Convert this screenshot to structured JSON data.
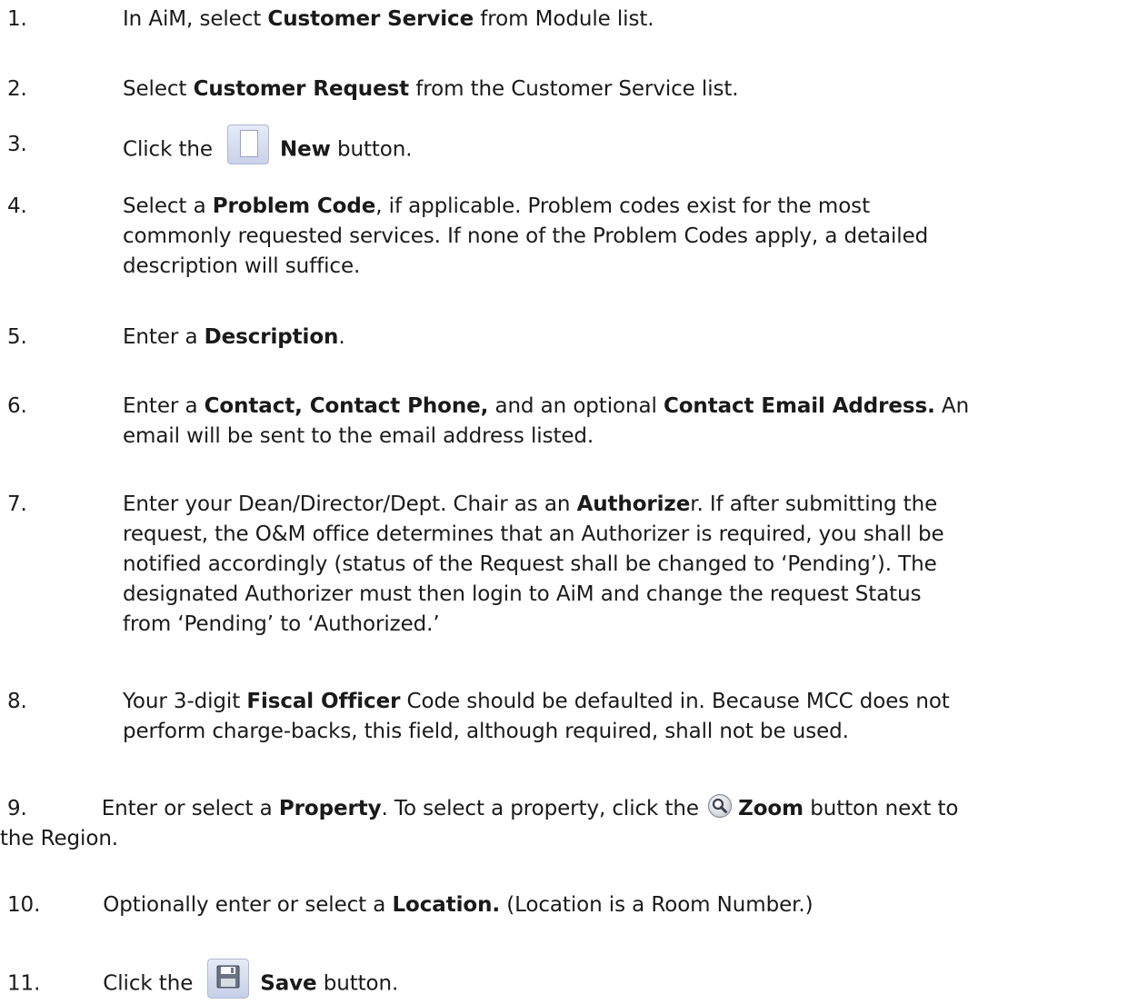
{
  "steps": [
    {
      "num": "1.",
      "parts": [
        "In AiM, select ",
        "Customer Service",
        " from Module list."
      ]
    },
    {
      "num": "2.",
      "parts": [
        "Select ",
        "Customer Request",
        " from the Customer Service list."
      ]
    },
    {
      "num": "3.",
      "parts": [
        "Click the",
        "New",
        " button."
      ],
      "icon": "new-document-icon"
    },
    {
      "num": "4.",
      "parts": [
        "Select a ",
        "Problem Code",
        ", if applicable.  Problem codes exist for the most",
        "commonly requested services.  If none of the Problem Codes apply, a detailed",
        "description will suffice."
      ]
    },
    {
      "num": "5.",
      "parts": [
        "Enter a ",
        "Description",
        "."
      ]
    },
    {
      "num": "6.",
      "parts": [
        "Enter a ",
        "Contact, Contact Phone,",
        " and an optional ",
        "Contact Email Address.",
        "  An",
        "email will be sent to the email address listed."
      ]
    },
    {
      "num": "7.",
      "parts": [
        "Enter your Dean/Director/Dept. Chair as an ",
        "Authorize",
        "r.  If after submitting the",
        "request, the O&M office determines that an Authorizer is required, you shall be",
        "notified accordingly (status of the Request shall be changed to ‘Pending’).  The",
        "designated Authorizer must then login to AiM and change the request Status",
        "from ‘Pending’ to ‘Authorized.’"
      ]
    },
    {
      "num": "8.",
      "parts": [
        "Your 3-digit ",
        "Fiscal Officer",
        " Code should be defaulted in.  Because MCC does not",
        "perform charge-backs, this field, although required, shall not be used."
      ]
    },
    {
      "num": "9.",
      "parts": [
        "Enter or select a ",
        "Property",
        ". To select a property, click the ",
        "Zoom",
        " button next to",
        "the Region."
      ],
      "icon": "zoom-magnifier-icon"
    },
    {
      "num": "10.",
      "parts": [
        "Optionally enter or select a ",
        "Location.",
        " (Location is a Room Number.)"
      ]
    },
    {
      "num": "11.",
      "parts": [
        "Click the",
        "Save",
        " button."
      ],
      "icon": "save-floppy-icon"
    }
  ]
}
